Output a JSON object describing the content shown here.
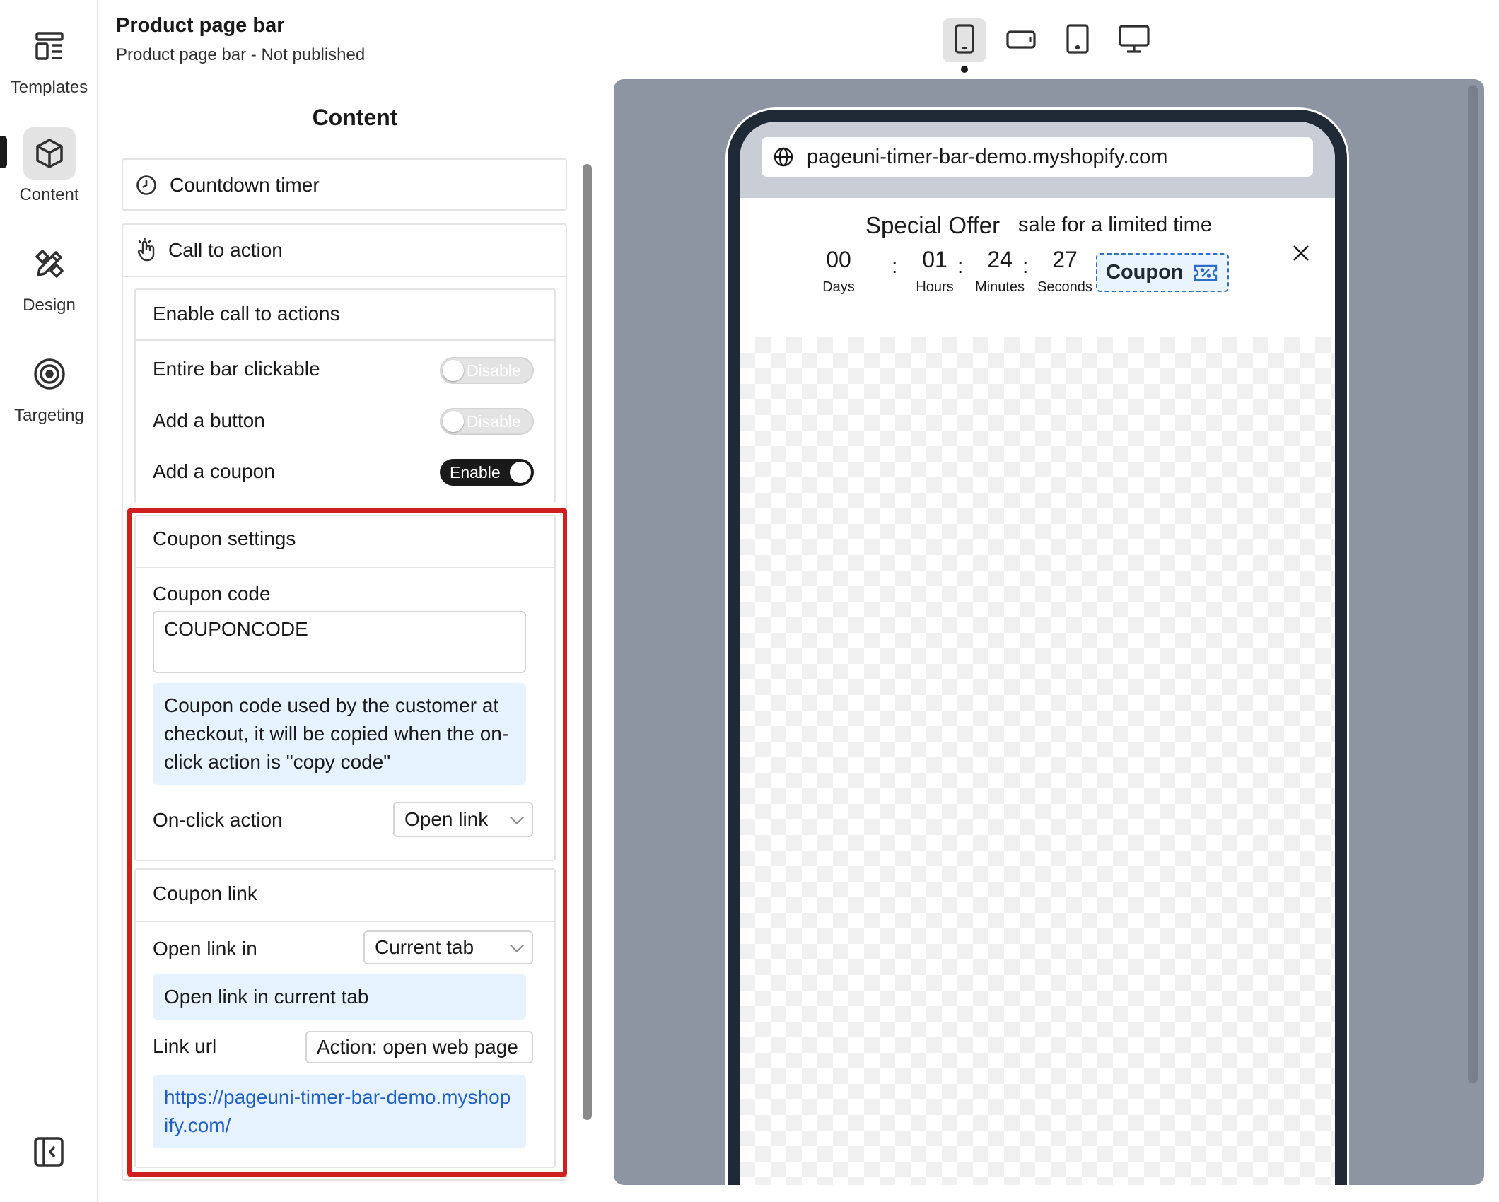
{
  "nav": {
    "items": [
      {
        "label": "Templates",
        "icon": "layout-templates-icon"
      },
      {
        "label": "Content",
        "icon": "cube-icon"
      },
      {
        "label": "Design",
        "icon": "pen-ruler-icon"
      },
      {
        "label": "Targeting",
        "icon": "target-icon"
      }
    ],
    "active": "Content",
    "collapse_icon": "sidebar-collapse-icon"
  },
  "header": {
    "title": "Product page bar",
    "subtitle": "Product page bar - Not published"
  },
  "content": {
    "title": "Content",
    "countdown_timer": "Countdown timer",
    "call_to_action": "Call to action",
    "enable_cta": {
      "title": "Enable call to actions",
      "entire_bar": {
        "label": "Entire bar clickable",
        "state": "Disable"
      },
      "add_button": {
        "label": "Add a button",
        "state": "Disable"
      },
      "add_coupon": {
        "label": "Add a coupon",
        "state": "Enable"
      }
    },
    "coupon_settings": {
      "title": "Coupon settings",
      "code_label": "Coupon code",
      "code_value": "COUPONCODE",
      "code_help": "Coupon code used by the customer at checkout, it will be copied when the on-click action is \"copy code\"",
      "onclick_label": "On-click action",
      "onclick_value": "Open link"
    },
    "coupon_link": {
      "title": "Coupon link",
      "open_in_label": "Open link in",
      "open_in_value": "Current tab",
      "open_in_help": "Open link in current tab",
      "url_label": "Link url",
      "url_action": "Action: open web page",
      "url_value": "https://pageuni-timer-bar-demo.myshopify.com/"
    }
  },
  "devices": {
    "options": [
      "mobile",
      "landscape",
      "tablet",
      "desktop"
    ],
    "active": "mobile"
  },
  "preview": {
    "url": "pageuni-timer-bar-demo.myshopify.com",
    "bar_title": "Special Offer",
    "bar_subtitle": "sale for a limited time",
    "countdown": [
      {
        "value": "00",
        "unit": "Days"
      },
      {
        "value": "01",
        "unit": "Hours"
      },
      {
        "value": "24",
        "unit": "Minutes"
      },
      {
        "value": "27",
        "unit": "Seconds"
      }
    ],
    "separator": ":",
    "coupon_label": "Coupon"
  },
  "colors": {
    "accent_red": "#d11f1f",
    "coupon_blue": "#2c6ecb",
    "info_bg": "#e6f2ff",
    "preview_bg": "#8e95a2"
  }
}
